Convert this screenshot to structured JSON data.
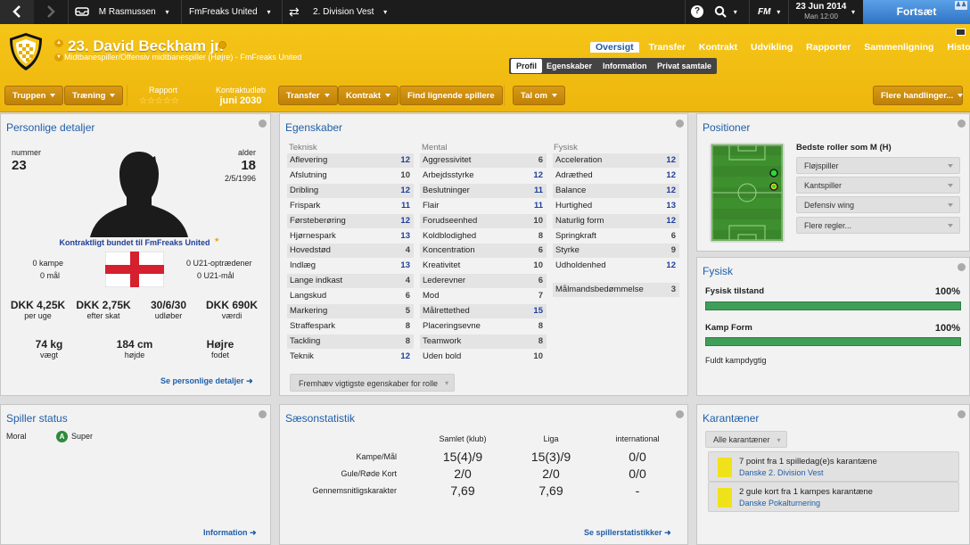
{
  "topbar": {
    "manager": "M Rasmussen",
    "club": "FmFreaks United",
    "competition": "2. Division Vest",
    "fm_label": "FM",
    "date": "23 Jun 2014",
    "time": "Man 12:00",
    "continue_label": "Fortsæt"
  },
  "header": {
    "title": "23. David Beckham jr.",
    "subtitle": "Midtbanespiller/Offensiv midtbanespiller (Højre) - FmFreaks United",
    "tabs": [
      "Oversigt",
      "Transfer",
      "Kontrakt",
      "Udvikling",
      "Rapporter",
      "Sammenligning",
      "Historie"
    ],
    "active_tab": "Oversigt",
    "subtabs": [
      "Profil",
      "Egenskaber",
      "Information",
      "Privat samtale"
    ],
    "active_subtab": "Profil",
    "buttons": {
      "squad": "Truppen",
      "training": "Træning",
      "transfer": "Transfer",
      "contract": "Kontrakt",
      "find_similar": "Find lignende spillere",
      "talk": "Tal om",
      "more": "Flere handlinger..."
    },
    "report_label": "Rapport",
    "report_stars": 0,
    "contract_label": "Kontraktudløb",
    "contract_value": "juni 2030"
  },
  "personal": {
    "title": "Personlige detaljer",
    "number_label": "nummer",
    "number": "23",
    "age_label": "alder",
    "age": "18",
    "dob": "2/5/1996",
    "contract_text": "Kontraktligt bundet til FmFreaks United",
    "matches": "0 kampe",
    "goals": "0 mål",
    "u21_apps": "0 U21-optrædener",
    "u21_goals": "0 U21-mål",
    "wage": "DKK 4,25K",
    "wage_label": "per uge",
    "after_tax": "DKK 2,75K",
    "after_tax_label": "efter skat",
    "expires": "30/6/30",
    "expires_label": "udløber",
    "value": "DKK 690K",
    "value_label": "værdi",
    "weight": "74 kg",
    "weight_label": "vægt",
    "height": "184 cm",
    "height_label": "højde",
    "foot": "Højre",
    "foot_label": "fodet",
    "link": "Se personlige detaljer"
  },
  "attributes": {
    "title": "Egenskaber",
    "technical_label": "Teknisk",
    "mental_label": "Mental",
    "physical_label": "Fysisk",
    "technical": [
      [
        "Aflevering",
        "12"
      ],
      [
        "Afslutning",
        "10"
      ],
      [
        "Dribling",
        "12"
      ],
      [
        "Frispark",
        "11"
      ],
      [
        "Førsteberøring",
        "12"
      ],
      [
        "Hjørnespark",
        "13"
      ],
      [
        "Hovedstød",
        "4"
      ],
      [
        "Indlæg",
        "13"
      ],
      [
        "Lange indkast",
        "4"
      ],
      [
        "Langskud",
        "6"
      ],
      [
        "Markering",
        "5"
      ],
      [
        "Straffespark",
        "8"
      ],
      [
        "Tackling",
        "8"
      ],
      [
        "Teknik",
        "12"
      ]
    ],
    "mental": [
      [
        "Aggressivitet",
        "6"
      ],
      [
        "Arbejdsstyrke",
        "12"
      ],
      [
        "Beslutninger",
        "11"
      ],
      [
        "Flair",
        "11"
      ],
      [
        "Forudseenhed",
        "10"
      ],
      [
        "Koldblodighed",
        "8"
      ],
      [
        "Koncentration",
        "6"
      ],
      [
        "Kreativitet",
        "10"
      ],
      [
        "Lederevner",
        "6"
      ],
      [
        "Mod",
        "7"
      ],
      [
        "Målrettethed",
        "15"
      ],
      [
        "Placeringsevne",
        "8"
      ],
      [
        "Teamwork",
        "8"
      ],
      [
        "Uden bold",
        "10"
      ]
    ],
    "physical": [
      [
        "Acceleration",
        "12"
      ],
      [
        "Adræthed",
        "12"
      ],
      [
        "Balance",
        "12"
      ],
      [
        "Hurtighed",
        "13"
      ],
      [
        "Naturlig form",
        "12"
      ],
      [
        "Springkraft",
        "6"
      ],
      [
        "Styrke",
        "9"
      ],
      [
        "Udholdenhed",
        "12"
      ]
    ],
    "goalkeeper": [
      "Målmandsbedømmelse",
      "3"
    ],
    "highlight_button": "Fremhæv vigtigste egenskaber for rolle"
  },
  "positions": {
    "title": "Positioner",
    "best_roles_label": "Bedste roller som M (H)",
    "roles": [
      "Fløjspiller",
      "Kantspiller",
      "Defensiv wing",
      "Flere regler..."
    ]
  },
  "physical": {
    "title": "Fysisk",
    "condition_label": "Fysisk tilstand",
    "condition": "100%",
    "condition_fraction": 1.0,
    "form_label": "Kamp Form",
    "form": "100%",
    "form_fraction": 1.0,
    "status": "Fuldt kampdygtig"
  },
  "player_status": {
    "title": "Spiller status",
    "morale_label": "Moral",
    "morale_badge": "A",
    "morale_value": "Super"
  },
  "season": {
    "title": "Sæsonstatistik",
    "columns": [
      "Samlet (klub)",
      "Liga",
      "international"
    ],
    "rows": [
      [
        "Kampe/Mål",
        "15(4)/9",
        "15(3)/9",
        "0/0"
      ],
      [
        "Gule/Røde Kort",
        "2/0",
        "2/0",
        "0/0"
      ],
      [
        "Gennemsnitligskarakter",
        "7,69",
        "7,69",
        "-"
      ]
    ],
    "link": "Se spillerstatistikker"
  },
  "suspensions": {
    "title": "Karantæner",
    "filter": "Alle karantæner",
    "items": [
      {
        "text": "7 point fra 1 spilledag(e)s karantæne",
        "comp": "Danske 2. Division Vest"
      },
      {
        "text": "2 gule kort fra 1 kampes karantæne",
        "comp": "Danske Pokalturnering"
      }
    ]
  },
  "info_link": "Information"
}
